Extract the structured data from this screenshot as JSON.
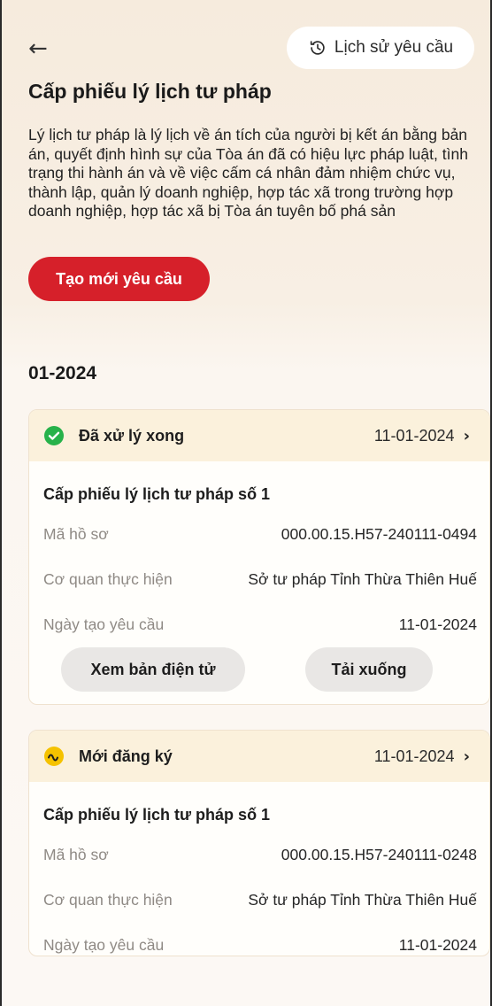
{
  "header": {
    "history_label": "Lịch sử yêu cầu",
    "title": "Cấp phiếu lý lịch tư pháp",
    "description": "Lý lịch tư pháp là lý lịch về án tích của người bị kết án bằng bản án, quyết định hình sự của Tòa án đã có hiệu lực pháp luật, tình trạng thi hành án và về việc cấm cá nhân đảm nhiệm chức vụ, thành lập, quản lý doanh nghiệp, hợp tác xã trong trường hợp doanh nghiệp, hợp tác xã bị Tòa án tuyên bố phá sản",
    "create_label": "Tạo mới yêu cầu"
  },
  "month_label": "01-2024",
  "colors": {
    "accent_red": "#d6202a",
    "done_green": "#27b24a",
    "new_yellow": "#f5c200"
  },
  "requests": [
    {
      "status": "Đã xử lý xong",
      "status_icon": "check-circle-icon",
      "date": "11-01-2024",
      "title": "Cấp phiếu lý lịch tư pháp số 1",
      "fields": [
        {
          "label": "Mã hồ sơ",
          "value": "000.00.15.H57-240111-0494"
        },
        {
          "label": "Cơ quan thực hiện",
          "value": "Sở tư pháp Tỉnh Thừa Thiên Huế"
        },
        {
          "label": "Ngày tạo yêu cầu",
          "value": "11-01-2024"
        }
      ],
      "actions": {
        "view": "Xem bản điện tử",
        "download": "Tải xuống"
      }
    },
    {
      "status": "Mới đăng ký",
      "status_icon": "wave-circle-icon",
      "date": "11-01-2024",
      "title": "Cấp phiếu lý lịch tư pháp số 1",
      "fields": [
        {
          "label": "Mã hồ sơ",
          "value": "000.00.15.H57-240111-0248"
        },
        {
          "label": "Cơ quan thực hiện",
          "value": "Sở tư pháp Tỉnh Thừa Thiên Huế"
        },
        {
          "label": "Ngày tạo yêu cầu",
          "value": "11-01-2024"
        }
      ]
    }
  ]
}
